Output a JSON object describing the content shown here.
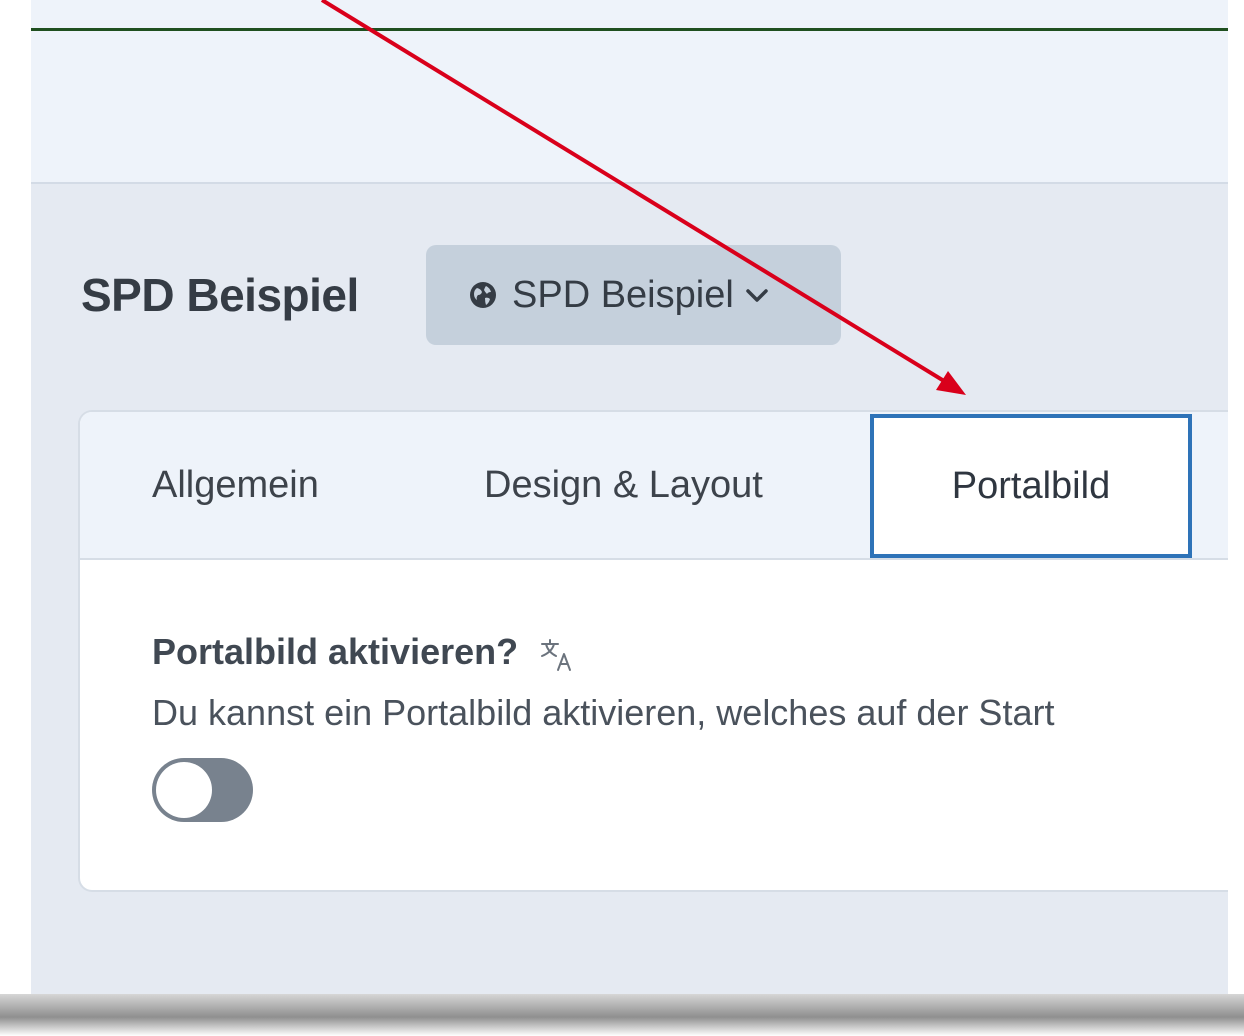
{
  "header": {
    "site_title": "SPD Beispiel",
    "site_selector_label": "SPD Beispiel"
  },
  "tabs": [
    {
      "label": "Allgemein",
      "active": false
    },
    {
      "label": "Design & Layout",
      "active": false
    },
    {
      "label": "Portalbild",
      "active": true
    }
  ],
  "field": {
    "label": "Portalbild aktivieren?",
    "description": "Du kannst ein Portalbild aktivieren, welches auf der Start",
    "toggle_on": false
  },
  "icons": {
    "globe": "globe-icon",
    "chevron": "chevron-down-icon",
    "translate": "translate-icon"
  },
  "colors": {
    "annotation_arrow": "#d9001b",
    "active_tab_border": "#2e73b8",
    "toggle_off": "#78828e",
    "accent_line": "#1f4f1f"
  }
}
